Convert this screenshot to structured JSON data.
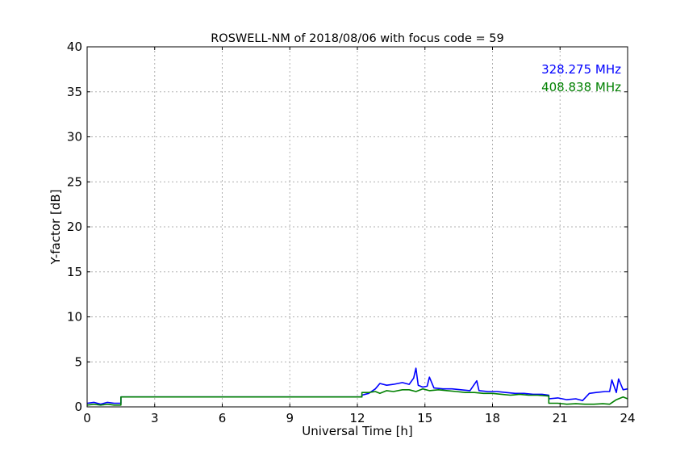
{
  "chart_data": {
    "type": "line",
    "title": "ROSWELL-NM of 2018/08/06 with focus code = 59",
    "xlabel": "Universal Time [h]",
    "ylabel": "Y-factor [dB]",
    "xlim": [
      0,
      24
    ],
    "ylim": [
      0,
      40
    ],
    "xticks": [
      0,
      3,
      6,
      9,
      12,
      15,
      18,
      21,
      24
    ],
    "yticks": [
      0,
      5,
      10,
      15,
      20,
      25,
      30,
      35,
      40
    ],
    "xtick_labels": [
      "0",
      "3",
      "6",
      "9",
      "12",
      "15",
      "18",
      "21",
      "24"
    ],
    "ytick_labels": [
      "0",
      "5",
      "10",
      "15",
      "20",
      "25",
      "30",
      "35",
      "40"
    ],
    "grid": true,
    "legend": "top-right",
    "series": [
      {
        "name": "328.275 MHz",
        "color": "#0000ff",
        "x": [
          0,
          0.3,
          0.6,
          0.9,
          1.2,
          1.5,
          1.5,
          3,
          6,
          9,
          12,
          12.2,
          12.2,
          12.5,
          12.8,
          13.0,
          13.3,
          13.6,
          14.0,
          14.3,
          14.5,
          14.6,
          14.7,
          14.9,
          15.1,
          15.2,
          15.4,
          15.8,
          16.2,
          16.6,
          17.0,
          17.3,
          17.4,
          17.8,
          18.2,
          18.6,
          19.0,
          19.4,
          19.8,
          20.2,
          20.5,
          20.5,
          20.9,
          21.3,
          21.7,
          22.0,
          22.3,
          22.6,
          23.0,
          23.2,
          23.3,
          23.5,
          23.6,
          23.8,
          24.0
        ],
        "y": [
          0.4,
          0.5,
          0.3,
          0.5,
          0.4,
          0.4,
          1.1,
          1.1,
          1.1,
          1.1,
          1.1,
          1.1,
          1.3,
          1.5,
          2.0,
          2.6,
          2.4,
          2.5,
          2.7,
          2.5,
          3.2,
          4.3,
          2.4,
          2.2,
          2.3,
          3.3,
          2.1,
          2.0,
          2.0,
          1.9,
          1.8,
          2.9,
          1.8,
          1.7,
          1.7,
          1.6,
          1.5,
          1.5,
          1.4,
          1.4,
          1.3,
          0.9,
          1.0,
          0.8,
          0.9,
          0.7,
          1.5,
          1.6,
          1.7,
          1.7,
          3.0,
          1.6,
          3.1,
          1.9,
          2.0
        ]
      },
      {
        "name": "408.838 MHz",
        "color": "#008000",
        "x": [
          0,
          0.3,
          0.6,
          0.9,
          1.2,
          1.5,
          1.5,
          3,
          6,
          9,
          12,
          12.2,
          12.2,
          12.5,
          12.8,
          13.0,
          13.3,
          13.6,
          14.0,
          14.3,
          14.6,
          14.9,
          15.2,
          15.6,
          16.0,
          16.4,
          16.8,
          17.2,
          17.6,
          18.0,
          18.4,
          18.8,
          19.2,
          19.6,
          20.0,
          20.5,
          20.5,
          20.9,
          21.3,
          21.7,
          22.1,
          22.5,
          22.9,
          23.2,
          23.5,
          23.8,
          24.0
        ],
        "y": [
          0.2,
          0.3,
          0.2,
          0.3,
          0.2,
          0.2,
          1.1,
          1.1,
          1.1,
          1.1,
          1.1,
          1.1,
          1.6,
          1.6,
          1.7,
          1.5,
          1.8,
          1.7,
          1.9,
          1.9,
          1.7,
          2.0,
          1.8,
          1.9,
          1.8,
          1.7,
          1.6,
          1.6,
          1.5,
          1.5,
          1.4,
          1.3,
          1.4,
          1.3,
          1.3,
          1.2,
          0.4,
          0.4,
          0.3,
          0.35,
          0.3,
          0.3,
          0.35,
          0.3,
          0.8,
          1.1,
          0.9
        ]
      }
    ]
  }
}
